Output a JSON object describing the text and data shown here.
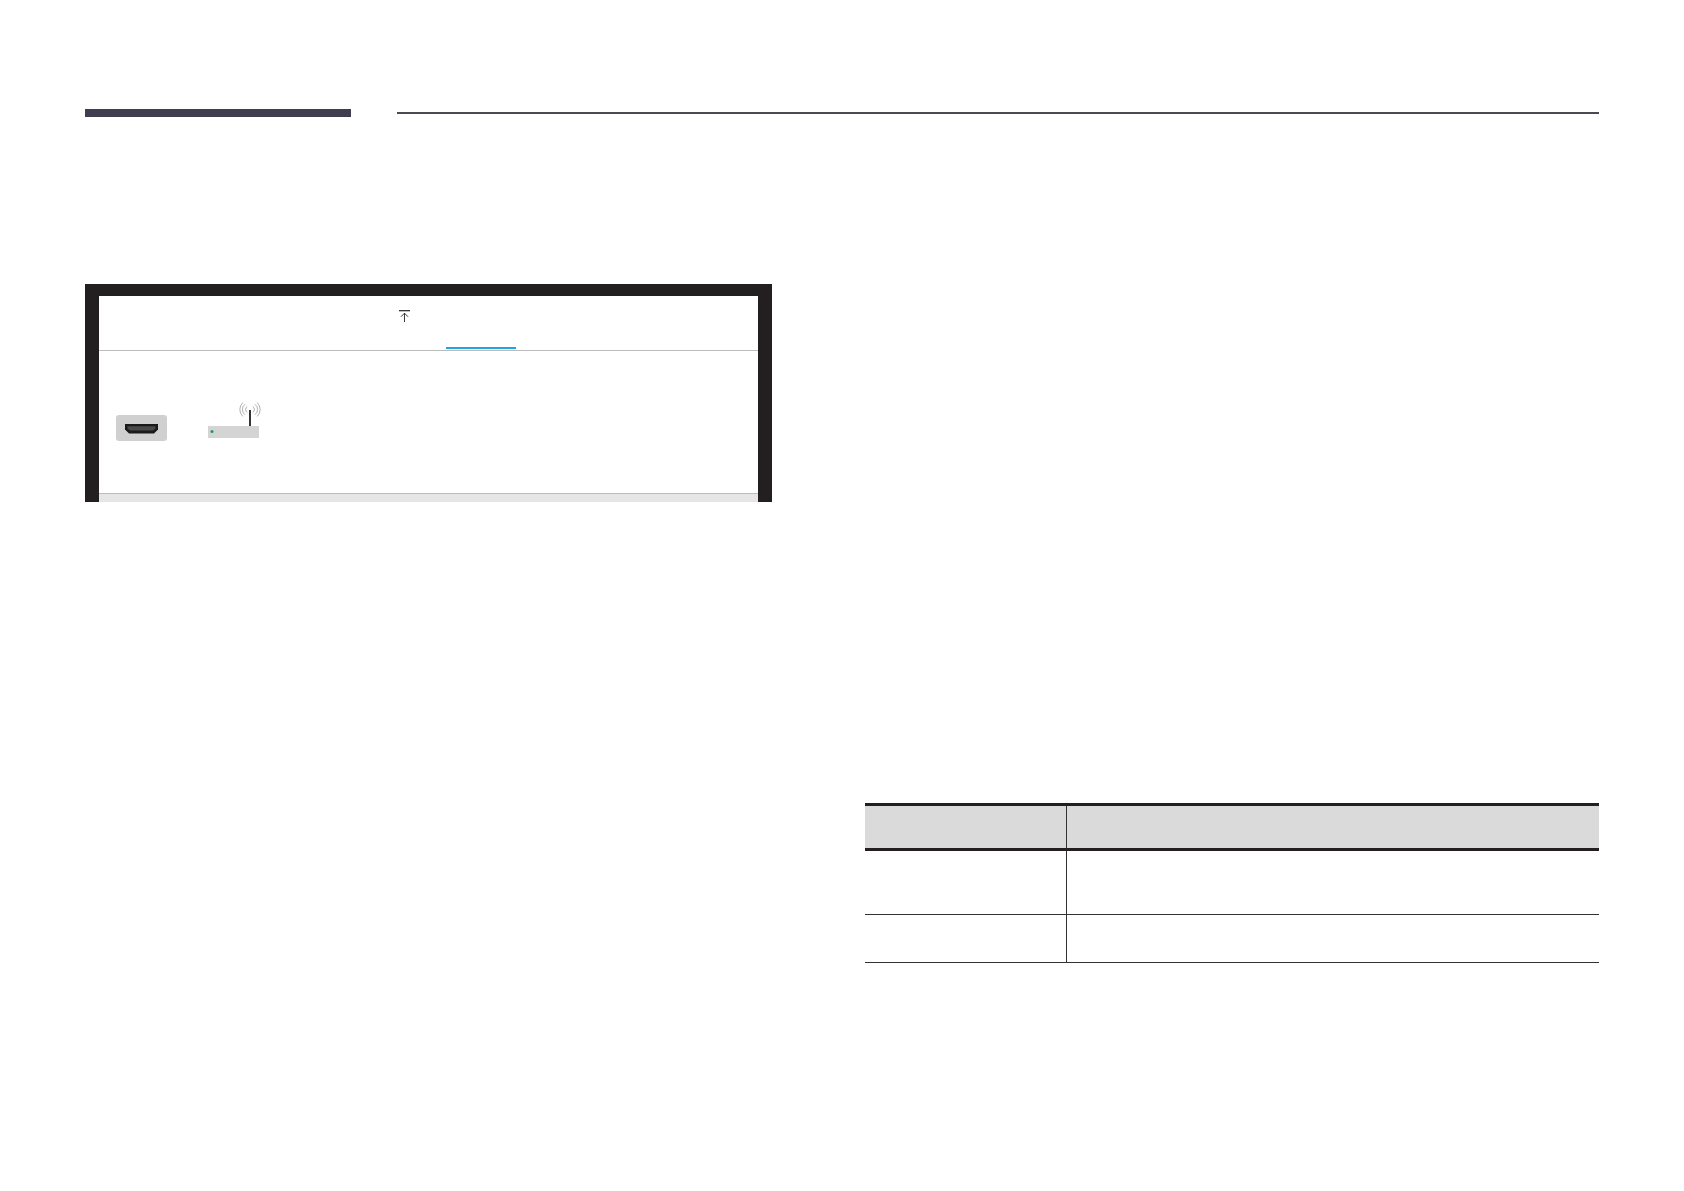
{
  "tv_screen": {
    "tabs": [
      {
        "selected": true
      }
    ],
    "sources": [
      {
        "kind": "hdmi"
      },
      {
        "kind": "router"
      }
    ]
  },
  "table": {
    "rows": [
      {
        "kind": "header"
      },
      {
        "kind": "body"
      },
      {
        "kind": "body"
      }
    ]
  }
}
